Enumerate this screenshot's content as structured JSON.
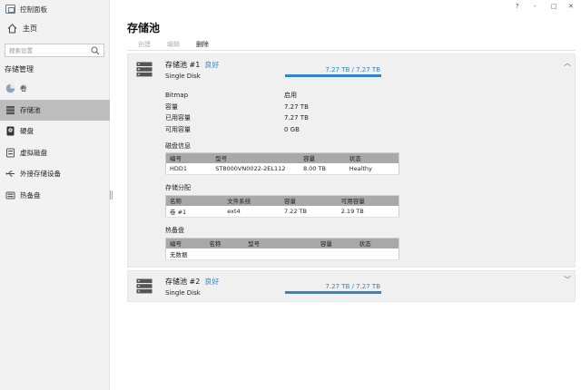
{
  "app": {
    "title": "控制面板"
  },
  "window_controls": {
    "help": "?",
    "minimize": "-",
    "maximize": "□",
    "close": "✕"
  },
  "sidebar": {
    "home_label": "主页",
    "search_placeholder": "搜索设置",
    "section": "存储管理",
    "items": [
      {
        "label": "卷",
        "icon": "volume-icon",
        "active": false
      },
      {
        "label": "存储池",
        "icon": "storage-pool-icon",
        "active": true
      },
      {
        "label": "硬盘",
        "icon": "hard-disk-icon",
        "active": false
      },
      {
        "label": "虚拟磁盘",
        "icon": "virtual-disk-icon",
        "active": false
      },
      {
        "label": "外接存储设备",
        "icon": "usb-icon",
        "active": false
      },
      {
        "label": "热备盘",
        "icon": "hot-spare-icon",
        "active": false
      }
    ]
  },
  "main": {
    "title": "存储池",
    "toolbar": {
      "create": "创建",
      "edit": "编辑",
      "delete": "删除"
    }
  },
  "pools": [
    {
      "name": "存储池 #1",
      "status": "良好",
      "type": "Single Disk",
      "capacity": "7.27 TB / 7.27 TB",
      "usage_fraction": 1.0,
      "expanded": true,
      "details": [
        {
          "key": "Bitmap",
          "value": "启用"
        },
        {
          "key": "容量",
          "value": "7.27 TB"
        },
        {
          "key": "已用容量",
          "value": "7.27 TB"
        },
        {
          "key": "可用容量",
          "value": "0 GB"
        }
      ],
      "disk_info": {
        "title": "磁盘信息",
        "headers": [
          "编号",
          "型号",
          "容量",
          "状态"
        ],
        "rows": [
          [
            "HDD1",
            "ST8000VN0022-2EL112",
            "8.00 TB",
            "Healthy"
          ]
        ]
      },
      "allocation": {
        "title": "存储分配",
        "headers": [
          "名称",
          "文件系统",
          "容量",
          "可用容量"
        ],
        "rows": [
          [
            "卷 #1",
            "ext4",
            "7.22 TB",
            "2.19 TB"
          ]
        ]
      },
      "hot_spare": {
        "title": "热备盘",
        "headers": [
          "编号",
          "名称",
          "型号",
          "容量",
          "状态"
        ],
        "empty_text": "无数据"
      }
    },
    {
      "name": "存储池 #2",
      "status": "良好",
      "type": "Single Disk",
      "capacity": "7.27 TB / 7.27 TB",
      "usage_fraction": 1.0,
      "expanded": false
    }
  ],
  "colors": {
    "accent": "#2f86c9",
    "healthy": "#1e8a3e",
    "sidebar_active": "#bdbdbd"
  }
}
